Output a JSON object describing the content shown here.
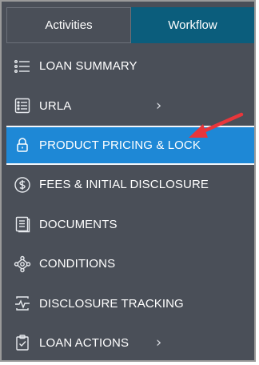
{
  "tabs": {
    "activities_label": "Activities",
    "workflow_label": "Workflow",
    "active_tab": "Workflow"
  },
  "menu": {
    "items": [
      {
        "label": "LOAN SUMMARY",
        "icon": "list-icon",
        "has_submenu": false,
        "selected": false
      },
      {
        "label": "URLA",
        "icon": "form-icon",
        "has_submenu": true,
        "selected": false
      },
      {
        "label": "PRODUCT PRICING & LOCK",
        "icon": "lock-icon",
        "has_submenu": false,
        "selected": true
      },
      {
        "label": "FEES & INITIAL DISCLOSURE",
        "icon": "dollar-circle-icon",
        "has_submenu": false,
        "selected": false
      },
      {
        "label": "DOCUMENTS",
        "icon": "documents-icon",
        "has_submenu": false,
        "selected": false
      },
      {
        "label": "CONDITIONS",
        "icon": "network-icon",
        "has_submenu": false,
        "selected": false
      },
      {
        "label": "DISCLOSURE TRACKING",
        "icon": "tracking-icon",
        "has_submenu": false,
        "selected": false
      },
      {
        "label": "LOAN ACTIONS",
        "icon": "clipboard-check-icon",
        "has_submenu": true,
        "selected": false
      }
    ]
  },
  "colors": {
    "panel_bg": "#4a4f58",
    "workflow_tab_bg": "#0b5d7c",
    "selected_bg": "#1e88d6",
    "annotation_arrow": "#e8363b"
  }
}
